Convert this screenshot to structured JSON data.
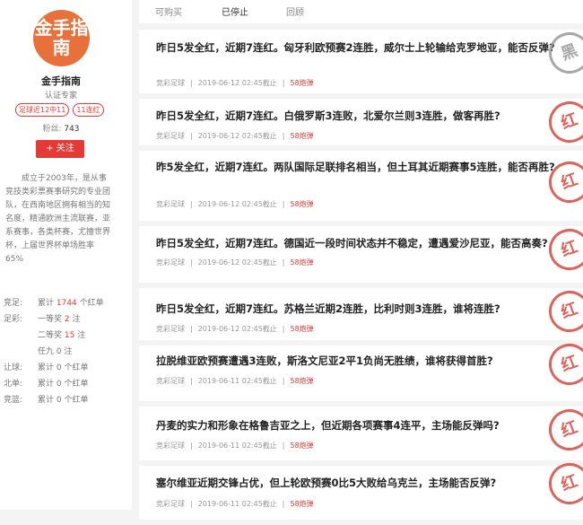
{
  "expert": {
    "logo_text": "金手指南",
    "name": "金手指南",
    "role": "认证专家",
    "badges": [
      "足球近12中11",
      "11连红"
    ],
    "fans_label": "粉丝:",
    "fans_count": "743",
    "follow_label": "+ 关注",
    "intro": "成立于2003年，是从事竞技类彩票赛事研究的专业团队，在西南地区拥有相当的知名度，精通欧洲主流联赛，亚系赛事，各类杯赛，尤擅世界杯，上届世界杯单场胜率65%"
  },
  "stats": [
    {
      "label": "竞足:",
      "prefix": "累计 ",
      "value": "1744",
      "suffix": " 个红单"
    },
    {
      "label": "足彩:",
      "prefix": "一等奖 ",
      "value": "2",
      "suffix": " 注"
    },
    {
      "label": "",
      "prefix": "二等奖 ",
      "value": "15",
      "suffix": " 注"
    },
    {
      "label": "",
      "prefix": "任九 ",
      "value": "0",
      "suffix": " 注"
    },
    {
      "label": "让球:",
      "prefix": "累计 ",
      "value": "0",
      "suffix": " 个红单"
    },
    {
      "label": "北单:",
      "prefix": "累计 ",
      "value": "0",
      "suffix": " 个红单"
    },
    {
      "label": "竞篮:",
      "prefix": "累计 ",
      "value": "0",
      "suffix": " 个红单"
    }
  ],
  "tabs": [
    "可购买",
    "已停止",
    "回顾"
  ],
  "items": [
    {
      "title": "昨日5发全红，近期7连红。匈牙利欧预赛2连胜，威尔士上轮输给克罗地亚，能否反弹?",
      "category": "竞彩足球",
      "time": "2019-06-12 02:45截止",
      "price": "58炮弹",
      "stamp": "黑"
    },
    {
      "title": "昨日5发全红，近期7连红。白俄罗斯3连败，北爱尔兰则3连胜，做客再胜?",
      "category": "竞彩足球",
      "time": "2019-06-12 02:45截止",
      "price": "58炮弹",
      "stamp": "红"
    },
    {
      "title": "昨5发全红，近期7连红。两队国际足联排名相当，但土耳其近期赛事5连胜，能否再胜?",
      "category": "竞彩足球",
      "time": "2019-06-12 02:45截止",
      "price": "58炮弹",
      "stamp": "红"
    },
    {
      "title": "昨日5发全红，近期7连红。德国近一段时间状态并不稳定，遭遇爱沙尼亚，能否高奏?",
      "category": "竞彩足球",
      "time": "2019-06-12 02:45截止",
      "price": "58炮弹",
      "stamp": "红"
    },
    {
      "title": "昨日5发全红，近期7连红。苏格兰近期2连胜，比利时则3连胜，谁将连胜?",
      "category": "竞彩足球",
      "time": "2019-06-12 02:45截止",
      "price": "58炮弹",
      "stamp": "红"
    },
    {
      "title": "拉脱维亚欧预赛遭遇3连败，斯洛文尼亚2平1负尚无胜绩，谁将获得首胜?",
      "category": "竞彩足球",
      "time": "2019-06-11 02:45截止",
      "price": "58炮弹",
      "stamp": "红"
    },
    {
      "title": "丹麦的实力和形象在格鲁吉亚之上，但近期各项赛事4连平，主场能反弹吗?",
      "category": "竞彩足球",
      "time": "2019-06-11 02:45截止",
      "price": "58炮弹",
      "stamp": "红"
    },
    {
      "title": "塞尔维亚近期交锋占优，但上轮欧预赛0比5大败给乌克兰，主场能否反弹?",
      "category": "竞彩足球",
      "time": "2019-06-11 02:45截止",
      "price": "58炮弹",
      "stamp": "红"
    }
  ]
}
